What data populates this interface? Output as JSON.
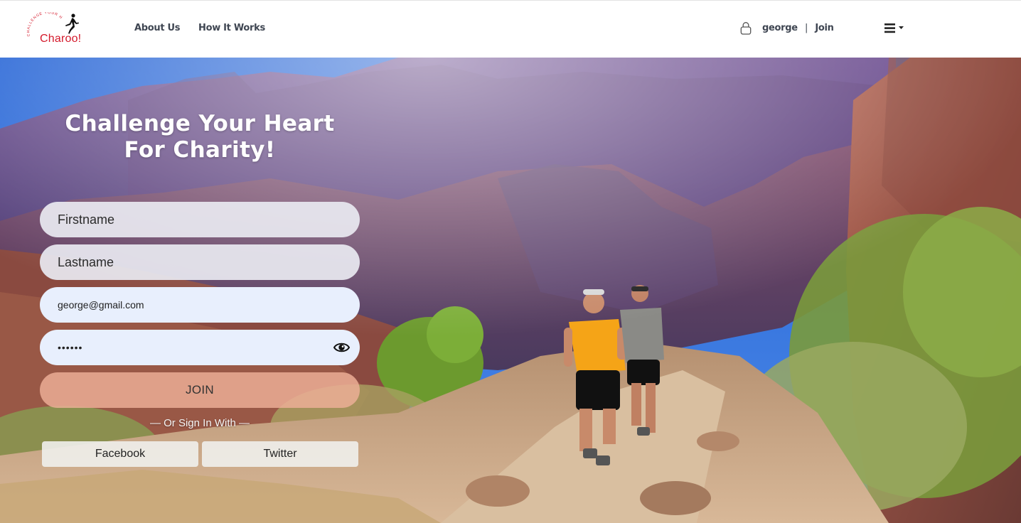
{
  "brand": {
    "name": "Charoo!",
    "tagline": "CHALLENGE YOUR HEART",
    "color": "#d4192b"
  },
  "nav": {
    "about": "About Us",
    "how_it_works": "How It Works"
  },
  "user": {
    "icon": "user-icon",
    "username": "george",
    "separator": "|",
    "join_label": "Join"
  },
  "menu": {
    "icon": "hamburger-menu-icon"
  },
  "hero": {
    "headline_line1": "Challenge Your Heart",
    "headline_line2": "For Charity!"
  },
  "form": {
    "firstname_placeholder": "Firstname",
    "lastname_placeholder": "Lastname",
    "email_value": "george@gmail.com",
    "password_value": "••••••",
    "password_toggle_icon": "eye-icon",
    "join_button": "JOIN",
    "or_sign_in": "— Or Sign In With —",
    "facebook_button": "Facebook",
    "twitter_button": "Twitter"
  },
  "colors": {
    "nav_text": "#3f4652",
    "join_button_bg": "#eeb098",
    "input_fill": "#e8effd"
  }
}
